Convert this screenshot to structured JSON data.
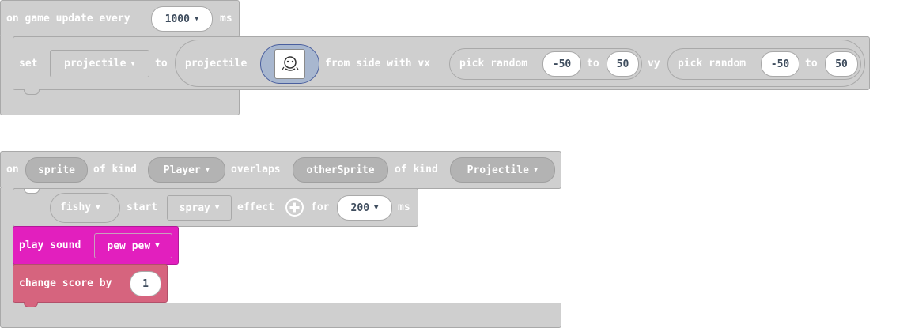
{
  "block1": {
    "on_game_update_every": "on game update every",
    "interval": "1000",
    "ms": "ms",
    "set": "set",
    "variable": "projectile",
    "to": "to",
    "projectile_label": "projectile",
    "from_side_with_vx": "from side with vx",
    "pick_random_1": "pick random",
    "vx_min": "-50",
    "to_1": "to",
    "vx_max": "50",
    "vy": "vy",
    "pick_random_2": "pick random",
    "vy_min": "-50",
    "to_2": "to",
    "vy_max": "50"
  },
  "block2": {
    "on": "on",
    "sprite": "sprite",
    "of_kind_1": "of kind",
    "kind_1": "Player",
    "overlaps": "overlaps",
    "other_sprite": "otherSprite",
    "of_kind_2": "of kind",
    "kind_2": "Projectile",
    "effect_target": "fishy",
    "start": "start",
    "effect": "spray",
    "effect_label": "effect",
    "for": "for",
    "duration": "200",
    "ms": "ms",
    "play_sound": "play sound",
    "sound": "pew pew",
    "change_score_by": "change score by",
    "score_delta": "1"
  },
  "colors": {
    "block_gray": "#cfcfcf",
    "music_pink": "#e21fbe",
    "info_rose": "#d6647e"
  },
  "icons": [
    "dropdown-caret-icon",
    "plus-circle-icon",
    "sprite-image-icon"
  ]
}
